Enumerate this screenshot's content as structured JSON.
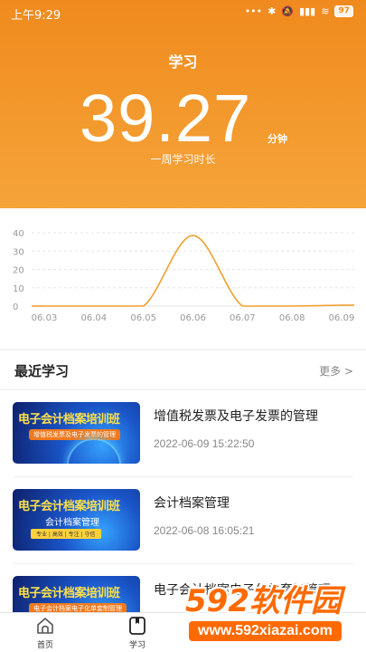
{
  "status_bar": {
    "time": "上午9:29",
    "battery": "97"
  },
  "header": {
    "title": "学习",
    "total_value": "39.27",
    "unit": "分钟",
    "caption": "一周学习时长"
  },
  "chart_data": {
    "type": "area",
    "x": [
      "06.03",
      "06.04",
      "06.05",
      "06.06",
      "06.07",
      "06.08",
      "06.09"
    ],
    "series": [
      {
        "values": [
          0,
          0,
          0,
          38.5,
          0,
          0,
          0.5
        ]
      }
    ],
    "ylim": [
      0,
      40
    ],
    "yticks": [
      0,
      10,
      20,
      30,
      40
    ],
    "grid": true,
    "color": "#f0a030"
  },
  "recent": {
    "title": "最近学习",
    "more_label": "更多 >",
    "items": [
      {
        "title": "增值税发票及电子发票的管理",
        "date": "2022-06-09 15:22:50",
        "thumb_title": "电子会计档案培训班",
        "thumb_sub": "增值税发票及电子发票的管理"
      },
      {
        "title": "会计档案管理",
        "date": "2022-06-08 16:05:21",
        "thumb_title": "电子会计档案培训班",
        "thumb_sub": "会计档案管理",
        "thumb_tags": "专业 | 高效 | 专注 | 守信"
      },
      {
        "title": "电子会计档案电子化单套制管理",
        "date": "2022",
        "thumb_title": "电子会计档案培训班",
        "thumb_sub": "电子会计档案电子化单套制管理"
      }
    ]
  },
  "tabbar": {
    "tabs": [
      {
        "label": "首页"
      },
      {
        "label": "学习"
      }
    ]
  },
  "watermark": {
    "main": "592软件园",
    "sub": "www.592xiazai.com"
  }
}
